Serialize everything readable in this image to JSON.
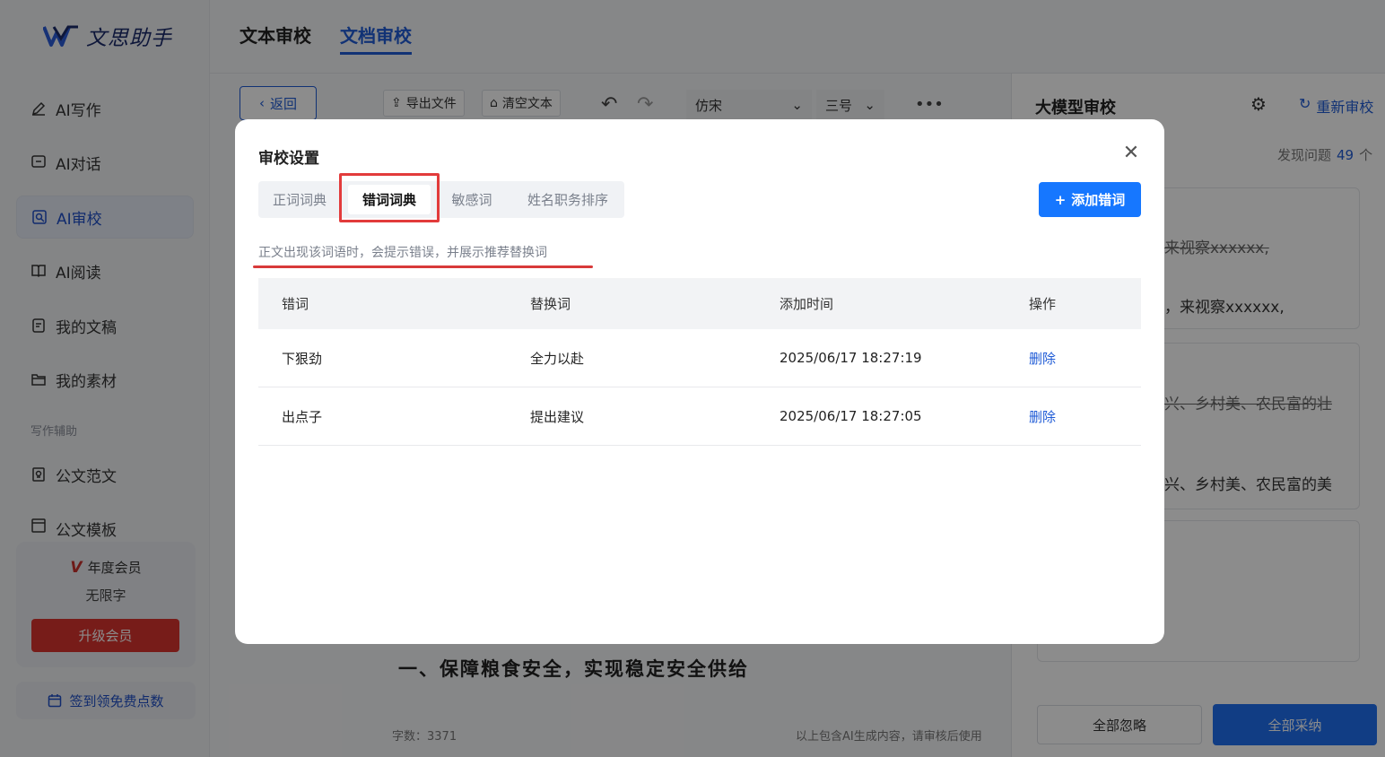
{
  "sidebar": {
    "logo_text": "文思助手",
    "nav": [
      {
        "label": "AI写作",
        "icon": "pen-icon"
      },
      {
        "label": "AI对话",
        "icon": "chat-icon"
      },
      {
        "label": "AI审校",
        "icon": "review-icon",
        "active": true
      },
      {
        "label": "AI阅读",
        "icon": "book-icon"
      },
      {
        "label": "我的文稿",
        "icon": "doc-icon"
      },
      {
        "label": "我的素材",
        "icon": "folder-icon"
      }
    ],
    "section_label": "写作辅助",
    "nav2": [
      {
        "label": "公文范文",
        "icon": "sample-icon"
      },
      {
        "label": "公文模板",
        "icon": "template-icon"
      }
    ],
    "member": {
      "badge": "V",
      "title": "年度会员",
      "sub": "无限字",
      "upgrade": "升级会员"
    },
    "signin": "签到领免费点数"
  },
  "header": {
    "tabs": [
      "文本审校",
      "文档审校"
    ],
    "active_tab": 1
  },
  "toolbar": {
    "back": "返回",
    "export": "导出文件",
    "clear": "清空文本",
    "font": "仿宋",
    "size": "三号",
    "more": "•••"
  },
  "editor": {
    "heading": "一、保障粮食安全，实现稳定安全供给",
    "word_count": "字数：3371",
    "ai_note": "以上包含AI生成内容，请审核后使用"
  },
  "right_panel": {
    "title": "大模型审校",
    "recheck": "重新审校",
    "found_label": "发现问题",
    "found_count": "49",
    "found_unit": "个",
    "card1_old": "来视察xxxxxx,",
    "card1_new": "，来视察xxxxxx,",
    "card2_old": "兴、乡村美、农民富的壮",
    "card2_new": "兴、乡村美、农民富的美",
    "ignore_all": "全部忽略",
    "adopt_all": "全部采纳"
  },
  "modal": {
    "title": "审校设置",
    "tabs": [
      "正词词典",
      "错词词典",
      "敏感词",
      "姓名职务排序"
    ],
    "active_tab": 1,
    "add_button": "添加错词",
    "hint": "正文出现该词语时，会提示错误，并展示推荐替换词",
    "columns": [
      "错词",
      "替换词",
      "添加时间",
      "操作"
    ],
    "rows": [
      {
        "wrong": "下狠劲",
        "replace": "全力以赴",
        "time": "2025/06/17 18:27:19",
        "action": "删除"
      },
      {
        "wrong": "出点子",
        "replace": "提出建议",
        "time": "2025/06/17 18:27:05",
        "action": "删除"
      }
    ]
  },
  "colors": {
    "primary": "#1677ff",
    "brand_blue": "#1f5bd6",
    "danger": "#d9342f",
    "highlight": "#e23b3b"
  }
}
